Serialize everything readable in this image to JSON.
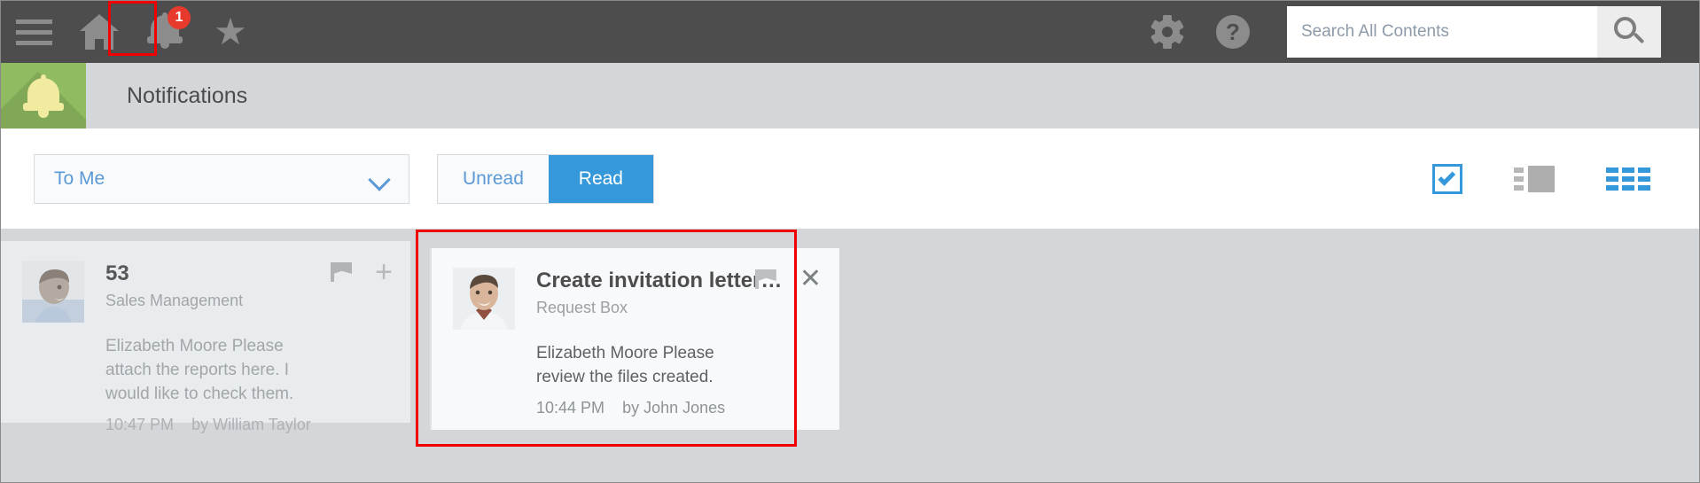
{
  "topbar": {
    "menu_icon": "hamburger-icon",
    "home_icon": "home-icon",
    "bell_icon": "bell-icon",
    "bell_badge": "1",
    "star_icon": "star-icon",
    "star_glyph": "★",
    "gear_icon": "gear-icon",
    "help_icon": "help-icon",
    "help_glyph": "?",
    "search": {
      "placeholder": "Search All Contents",
      "value": "",
      "button_icon": "search-icon"
    },
    "background": "#4d4d4d"
  },
  "section": {
    "icon": "bell-icon",
    "title": "Notifications",
    "tile_color": "#90bb61"
  },
  "toolbar": {
    "recipient_filter": {
      "selected": "To Me",
      "chevron_icon": "chevron-down-icon"
    },
    "tabs": [
      {
        "label": "Unread",
        "active": false
      },
      {
        "label": "Read",
        "active": true
      }
    ],
    "view_controls": [
      {
        "name": "select-all-checkbox",
        "icon": "checkbox-checked-icon",
        "color": "#3498db"
      },
      {
        "name": "list-view-toggle",
        "icon": "list-view-icon",
        "color": "#aeaeae"
      },
      {
        "name": "grid-view-toggle",
        "icon": "grid-view-icon",
        "color": "#3498db"
      }
    ],
    "accent_color": "#3498db",
    "link_color": "#5b9ad6"
  },
  "notifications": [
    {
      "title": "53",
      "source": "Sales Management",
      "message": "Elizabeth Moore Please attach the reports here. I would like to check them.",
      "time": "10:47 PM",
      "author": "by William Taylor",
      "avatar_name": "avatar-william-taylor",
      "actions": [
        "flag-icon",
        "plus-icon"
      ]
    },
    {
      "title": "Create invitation letter…",
      "source": "Request Box",
      "message": "Elizabeth Moore Please review the files created.",
      "time": "10:44 PM",
      "author": "by John Jones",
      "avatar_name": "avatar-john-jones",
      "actions": [
        "flag-icon",
        "close-icon"
      ],
      "highlighted": true
    }
  ],
  "annotations": {
    "highlight_color": "#f10000",
    "targets": [
      "bell-icon",
      "notification-card-2"
    ]
  }
}
